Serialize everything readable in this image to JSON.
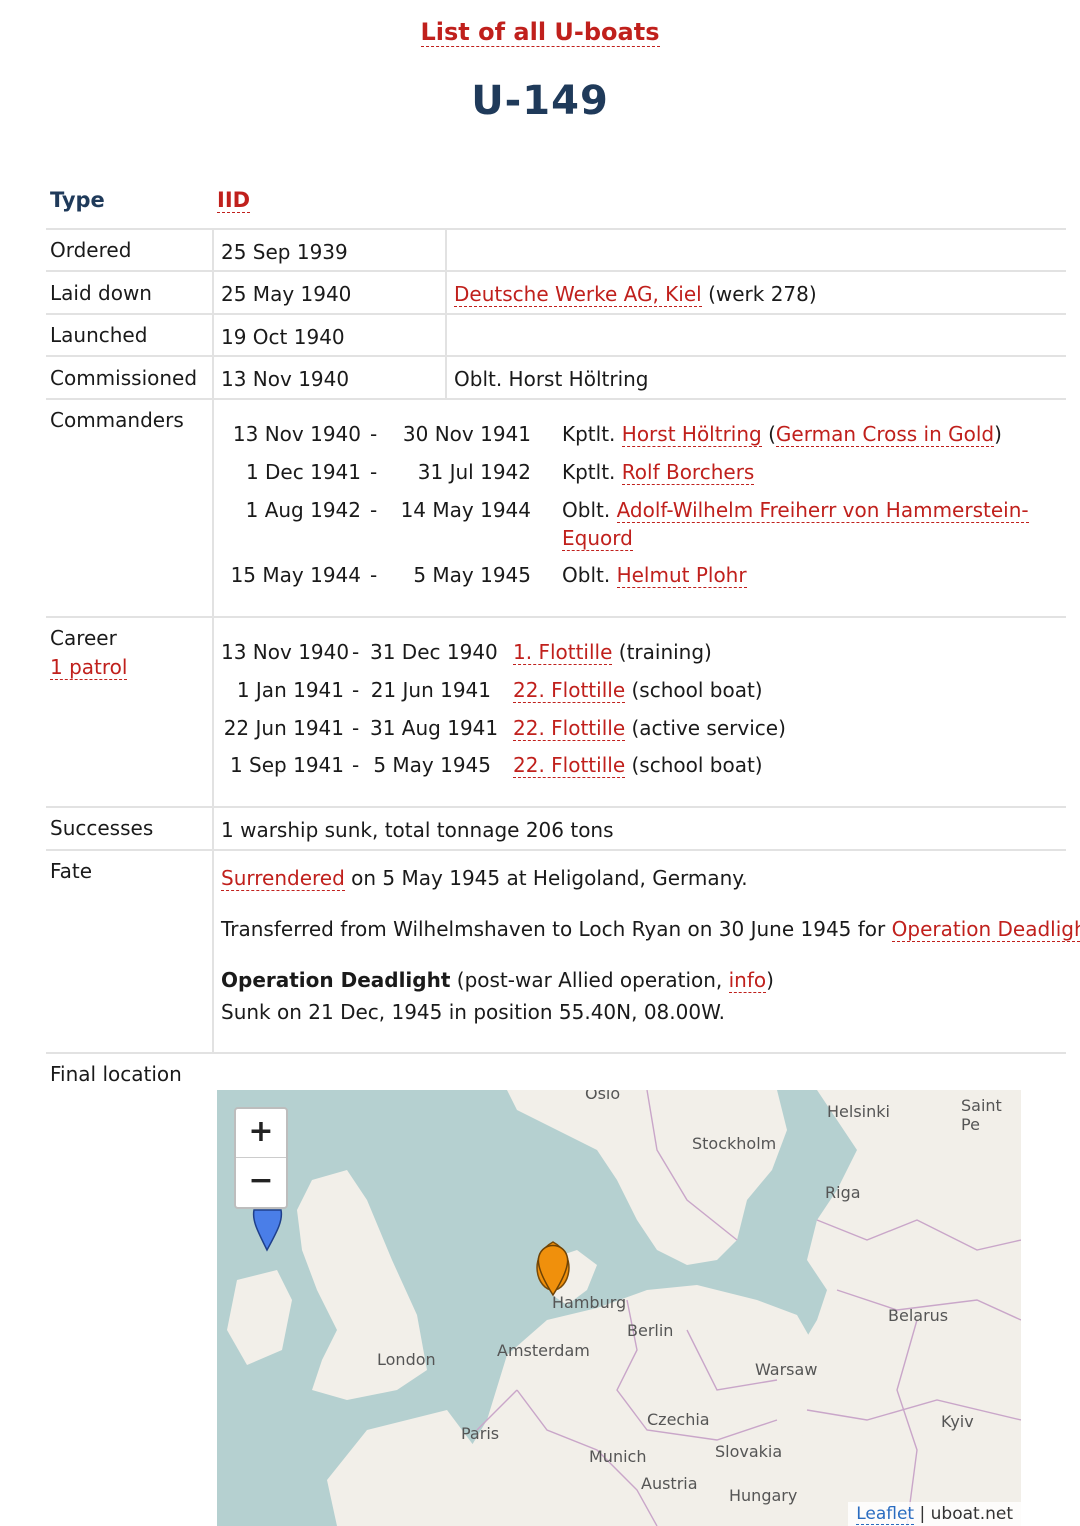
{
  "header": {
    "list_link": "List of all U-boats",
    "title": "U-149"
  },
  "type_row": {
    "label": "Type",
    "value": "IID"
  },
  "ordered": {
    "label": "Ordered",
    "value": "25 Sep 1939"
  },
  "laid_down": {
    "label": "Laid down",
    "value": "25 May 1940",
    "yard": "Deutsche Werke AG, Kiel",
    "werk": "(werk 278)"
  },
  "launched": {
    "label": "Launched",
    "value": "19 Oct 1940"
  },
  "commissioned": {
    "label": "Commissioned",
    "value": "13 Nov 1940",
    "commander": "Oblt. Horst Höltring"
  },
  "commanders": {
    "label": "Commanders",
    "rows": [
      {
        "from": "13 Nov 1940",
        "dash": "-",
        "to": "30 Nov 1941",
        "rank": "Kptlt.",
        "name": "Horst Höltring",
        "pre": " (",
        "award": "German Cross in Gold",
        "post": ")"
      },
      {
        "from": "1 Dec 1941",
        "dash": "-",
        "to": "31 Jul 1942",
        "rank": "Kptlt.",
        "name": "Rolf Borchers"
      },
      {
        "from": "1 Aug 1942",
        "dash": "-",
        "to": "14 May 1944",
        "rank": "Oblt.",
        "name_line1": "Adolf-Wilhelm Freiherr von Hammerstein-",
        "name_line2": "Equord"
      },
      {
        "from": "15 May 1944",
        "dash": "-",
        "to": "5 May 1945",
        "rank": "Oblt.",
        "name": "Helmut Plohr"
      }
    ]
  },
  "career": {
    "label": "Career",
    "patrol_link": "1 patrol",
    "rows": [
      {
        "from": "13 Nov 1940",
        "dash": "-",
        "to": "31 Dec 1940",
        "flotilla": "1. Flottille",
        "note": "(training)"
      },
      {
        "from": "1 Jan 1941",
        "dash": "-",
        "to": "21 Jun 1941",
        "flotilla": "22. Flottille",
        "note": "(school boat)"
      },
      {
        "from": "22 Jun 1941",
        "dash": "-",
        "to": "31 Aug 1941",
        "flotilla": "22. Flottille",
        "note": "(active service)"
      },
      {
        "from": "1 Sep 1941",
        "dash": "-",
        "to": "5 May 1945",
        "flotilla": "22. Flottille",
        "note": "(school boat)"
      }
    ]
  },
  "successes": {
    "label": "Successes",
    "value": "1 warship sunk, total tonnage 206 tons"
  },
  "fate": {
    "label": "Fate",
    "surrendered_link": "Surrendered",
    "surrendered_rest": "on 5 May 1945 at Heligoland, Germany.",
    "transfer_text": "Transferred from Wilhelmshaven to Loch Ryan on 30 June 1945 for",
    "deadlight_link": "Operation Deadlight",
    "transfer_end": ".",
    "od_bold": "Operation Deadlight",
    "od_paren_open": "(post-war Allied operation,",
    "info_link": "info",
    "od_paren_close": ")",
    "sunk_text": "Sunk on 21 Dec, 1945 in position 55.40N, 08.00W."
  },
  "final_location": {
    "label": "Final location",
    "zoom_in": "+",
    "zoom_out": "−",
    "attribution_link": "Leaflet",
    "attribution_sep": "|",
    "attribution_text": "uboat.net",
    "cities": [
      "Oslo",
      "Helsinki",
      "Saint Pe",
      "Stockholm",
      "Riga",
      "Hamburg",
      "Berlin",
      "Belarus",
      "Amsterdam",
      "London",
      "Warsaw",
      "Paris",
      "Czechia",
      "Kyiv",
      "Munich",
      "Slovakia",
      "Austria",
      "Hungary"
    ],
    "colors": {
      "sea": "#b5d0d0",
      "land": "#f2efe9",
      "marker_orange": "#f0900c",
      "marker_blue": "#4a7ee8"
    }
  }
}
